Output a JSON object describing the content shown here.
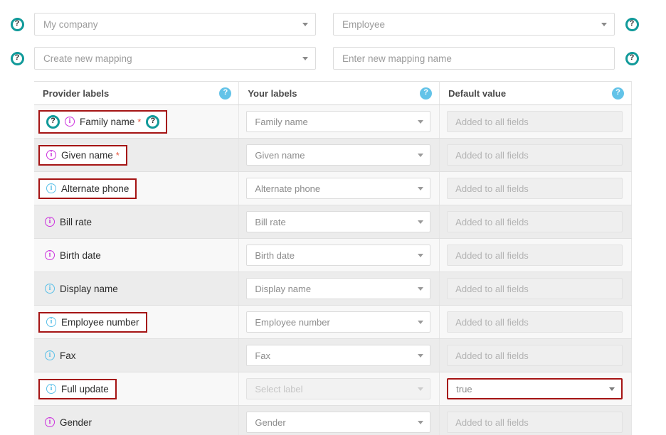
{
  "top_form": {
    "rows": [
      {
        "left_help_icon": "help-question-icon",
        "left": {
          "type": "select",
          "value": "My company",
          "caret": "chevron-down-icon"
        },
        "right": {
          "type": "select",
          "value": "Employee",
          "caret": "chevron-down-icon"
        },
        "right_help_icon": "help-question-icon"
      },
      {
        "left_help_icon": "help-question-icon",
        "left": {
          "type": "select",
          "value": "Create new mapping",
          "caret": "chevron-down-icon"
        },
        "right": {
          "type": "text",
          "placeholder": "Enter new mapping name",
          "value": ""
        },
        "right_help_icon": "help-question-icon"
      }
    ]
  },
  "table": {
    "columns": [
      {
        "label": "Provider labels",
        "help_icon": "help-question-icon"
      },
      {
        "label": "Your labels",
        "help_icon": "help-question-icon"
      },
      {
        "label": "Default value",
        "help_icon": "help-question-icon"
      }
    ],
    "rows": [
      {
        "provider_label": "Family name",
        "required": true,
        "required_marker": "*",
        "info_icon_color": "magenta",
        "leading_help_icon": true,
        "trailing_help_icon": true,
        "highlighted": true,
        "your_label": {
          "value": "Family name",
          "disabled": false,
          "highlighted": false
        },
        "default_value": {
          "type": "text",
          "placeholder": "Added to all fields",
          "value": "",
          "highlighted": false
        }
      },
      {
        "provider_label": "Given name",
        "required": true,
        "required_marker": "*",
        "info_icon_color": "magenta",
        "leading_help_icon": false,
        "trailing_help_icon": false,
        "highlighted": true,
        "your_label": {
          "value": "Given name",
          "disabled": false,
          "highlighted": false
        },
        "default_value": {
          "type": "text",
          "placeholder": "Added to all fields",
          "value": "",
          "highlighted": false
        }
      },
      {
        "provider_label": "Alternate phone",
        "required": false,
        "required_marker": "",
        "info_icon_color": "lightblue",
        "leading_help_icon": false,
        "trailing_help_icon": false,
        "highlighted": true,
        "your_label": {
          "value": "Alternate phone",
          "disabled": false,
          "highlighted": false
        },
        "default_value": {
          "type": "text",
          "placeholder": "Added to all fields",
          "value": "",
          "highlighted": false
        }
      },
      {
        "provider_label": "Bill rate",
        "required": false,
        "required_marker": "",
        "info_icon_color": "magenta",
        "leading_help_icon": false,
        "trailing_help_icon": false,
        "highlighted": false,
        "your_label": {
          "value": "Bill rate",
          "disabled": false,
          "highlighted": false
        },
        "default_value": {
          "type": "text",
          "placeholder": "Added to all fields",
          "value": "",
          "highlighted": false
        }
      },
      {
        "provider_label": "Birth date",
        "required": false,
        "required_marker": "",
        "info_icon_color": "magenta",
        "leading_help_icon": false,
        "trailing_help_icon": false,
        "highlighted": false,
        "your_label": {
          "value": "Birth date",
          "disabled": false,
          "highlighted": false
        },
        "default_value": {
          "type": "text",
          "placeholder": "Added to all fields",
          "value": "",
          "highlighted": false
        }
      },
      {
        "provider_label": "Display name",
        "required": false,
        "required_marker": "",
        "info_icon_color": "lightblue",
        "leading_help_icon": false,
        "trailing_help_icon": false,
        "highlighted": false,
        "your_label": {
          "value": "Display name",
          "disabled": false,
          "highlighted": false
        },
        "default_value": {
          "type": "text",
          "placeholder": "Added to all fields",
          "value": "",
          "highlighted": false
        }
      },
      {
        "provider_label": "Employee number",
        "required": false,
        "required_marker": "",
        "info_icon_color": "lightblue",
        "leading_help_icon": false,
        "trailing_help_icon": false,
        "highlighted": true,
        "your_label": {
          "value": "Employee number",
          "disabled": false,
          "highlighted": false
        },
        "default_value": {
          "type": "text",
          "placeholder": "Added to all fields",
          "value": "",
          "highlighted": false
        }
      },
      {
        "provider_label": "Fax",
        "required": false,
        "required_marker": "",
        "info_icon_color": "lightblue",
        "leading_help_icon": false,
        "trailing_help_icon": false,
        "highlighted": false,
        "your_label": {
          "value": "Fax",
          "disabled": false,
          "highlighted": false
        },
        "default_value": {
          "type": "text",
          "placeholder": "Added to all fields",
          "value": "",
          "highlighted": false
        }
      },
      {
        "provider_label": "Full update",
        "required": false,
        "required_marker": "",
        "info_icon_color": "lightblue",
        "leading_help_icon": false,
        "trailing_help_icon": false,
        "highlighted": true,
        "your_label": {
          "value": "Select label",
          "disabled": true,
          "highlighted": false
        },
        "default_value": {
          "type": "select",
          "value": "true",
          "highlighted": true
        }
      },
      {
        "provider_label": "Gender",
        "required": false,
        "required_marker": "",
        "info_icon_color": "magenta",
        "leading_help_icon": false,
        "trailing_help_icon": false,
        "highlighted": false,
        "your_label": {
          "value": "Gender",
          "disabled": false,
          "highlighted": false
        },
        "default_value": {
          "type": "text",
          "placeholder": "Added to all fields",
          "value": "",
          "highlighted": false
        }
      }
    ]
  },
  "glyphs": {
    "question": "?",
    "info": "i"
  },
  "colors": {
    "help_teal": "#119a9a",
    "help_blue": "#63c3e8",
    "info_magenta": "#cc33dd",
    "info_lightblue": "#5bc0e8",
    "highlight_red": "#a51414",
    "required_red": "#e8553c"
  }
}
